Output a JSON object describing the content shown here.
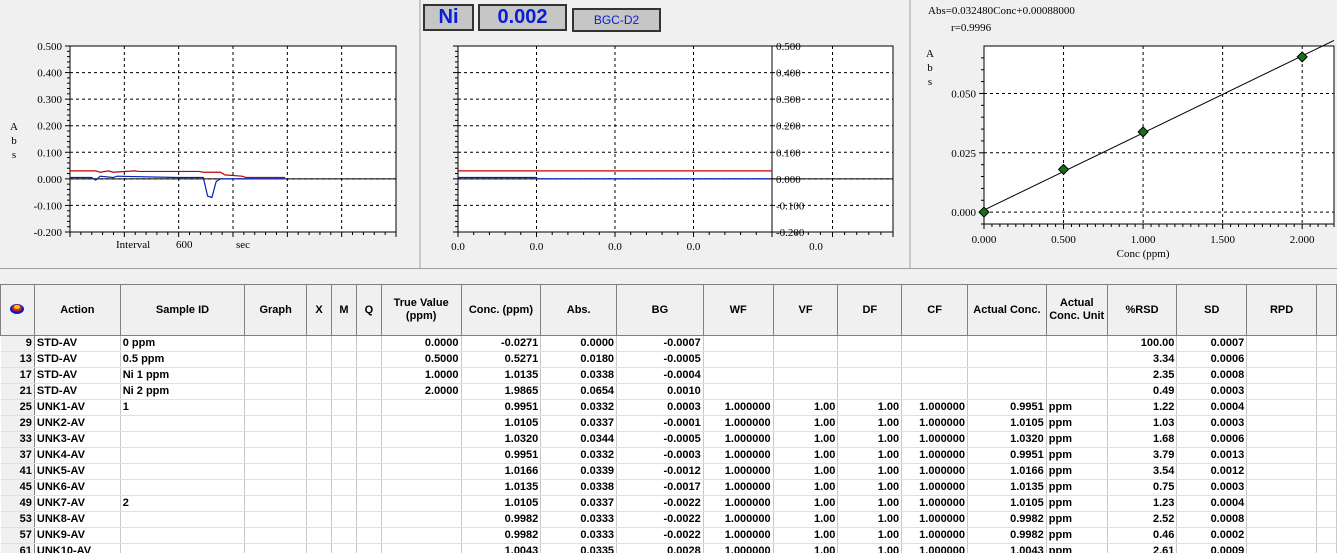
{
  "colors": {
    "signal_red": "#c00000",
    "signal_blue": "#0020c0",
    "accent_blue": "#0a1cd6",
    "marker_green": "#1a6e1a"
  },
  "element": {
    "symbol": "Ni",
    "conc": "0.002",
    "sample": "BGC-D2"
  },
  "chart_data": [
    {
      "type": "line",
      "title": "",
      "ylabel": "Abs",
      "xlabel": "sec",
      "interval_label": "Interval",
      "interval_value": "600",
      "ylim": [
        -0.2,
        0.5
      ],
      "yticks": [
        "0.500",
        "0.400",
        "0.300",
        "0.200",
        "0.100",
        "0.000",
        "-0.100",
        "-0.200"
      ],
      "grid": true,
      "series": [
        {
          "name": "",
          "color": "#c00000",
          "x": [
            0,
            0.12,
            0.14,
            0.18,
            0.2,
            0.3,
            0.32,
            0.6,
            0.62,
            0.7,
            0.72,
            0.8,
            0.82,
            0.9,
            1.0
          ],
          "y": [
            0.03,
            0.03,
            0.025,
            0.03,
            0.025,
            0.03,
            0.028,
            0.028,
            0.025,
            0.025,
            0.015,
            0.01,
            0.005,
            0.005,
            0.005
          ]
        },
        {
          "name": "",
          "color": "#0020c0",
          "x": [
            0,
            0.1,
            0.12,
            0.14,
            0.2,
            0.22,
            0.5,
            0.62,
            0.64,
            0.66,
            0.68,
            0.7,
            1.0
          ],
          "y": [
            0.005,
            0.005,
            -0.005,
            0.01,
            0.005,
            0.01,
            0.005,
            0.005,
            -0.065,
            -0.07,
            -0.01,
            0.0,
            0.0
          ]
        }
      ]
    },
    {
      "type": "line",
      "title": "",
      "ylim": [
        -0.2,
        0.5
      ],
      "yticks": [
        "0.500",
        "0.400",
        "0.300",
        "0.200",
        "0.100",
        "0.000",
        "-0.100",
        "-0.200"
      ],
      "xticks": [
        "0.0",
        "0.0",
        "0.0",
        "0.0",
        "0.0"
      ],
      "grid": true,
      "series": [
        {
          "name": "",
          "color": "#c00000",
          "x": [
            0,
            1
          ],
          "y": [
            0.03,
            0.03
          ]
        },
        {
          "name": "",
          "color": "#0020c0",
          "x": [
            0,
            0.25,
            0.25,
            1
          ],
          "y": [
            0.005,
            0.005,
            0.0,
            0.0
          ]
        }
      ]
    },
    {
      "type": "scatter",
      "title": "Abs=0.032480Conc+0.00088000",
      "subtitle": "r=0.9996",
      "ylabel": "Abs",
      "xlabel": "Conc (ppm)",
      "xlim": [
        0,
        2.2
      ],
      "ylim": [
        -0.005,
        0.07
      ],
      "xticks": [
        "0.000",
        "0.500",
        "1.000",
        "1.500",
        "2.000"
      ],
      "yticks": [
        "0.050",
        "0.025",
        "0.000"
      ],
      "grid": true,
      "points": {
        "x": [
          0.0,
          0.5,
          1.0,
          2.0
        ],
        "y": [
          0.0,
          0.018,
          0.0338,
          0.0654
        ]
      },
      "fit": {
        "slope": 0.03248,
        "intercept": 0.00088
      }
    }
  ],
  "table": {
    "columns": [
      "Action",
      "Sample ID",
      "Graph",
      "X",
      "M",
      "Q",
      "True Value (ppm)",
      "Conc. (ppm)",
      "Abs.",
      "BG",
      "WF",
      "VF",
      "DF",
      "CF",
      "Actual Conc.",
      "Actual Conc. Unit",
      "%RSD",
      "SD",
      "RPD"
    ],
    "rows": [
      {
        "n": "9",
        "action": "STD-AV",
        "sid": "0 ppm",
        "tv": "0.0000",
        "conc": "-0.0271",
        "abs": "0.0000",
        "bg": "-0.0007",
        "wf": "",
        "vf": "",
        "df": "",
        "cf": "",
        "ac": "",
        "unit": "",
        "rsd": "100.00",
        "sd": "0.0007"
      },
      {
        "n": "13",
        "action": "STD-AV",
        "sid": "0.5 ppm",
        "tv": "0.5000",
        "conc": "0.5271",
        "abs": "0.0180",
        "bg": "-0.0005",
        "wf": "",
        "vf": "",
        "df": "",
        "cf": "",
        "ac": "",
        "unit": "",
        "rsd": "3.34",
        "sd": "0.0006"
      },
      {
        "n": "17",
        "action": "STD-AV",
        "sid": "Ni 1 ppm",
        "tv": "1.0000",
        "conc": "1.0135",
        "abs": "0.0338",
        "bg": "-0.0004",
        "wf": "",
        "vf": "",
        "df": "",
        "cf": "",
        "ac": "",
        "unit": "",
        "rsd": "2.35",
        "sd": "0.0008"
      },
      {
        "n": "21",
        "action": "STD-AV",
        "sid": "Ni 2 ppm",
        "tv": "2.0000",
        "conc": "1.9865",
        "abs": "0.0654",
        "bg": "0.0010",
        "wf": "",
        "vf": "",
        "df": "",
        "cf": "",
        "ac": "",
        "unit": "",
        "rsd": "0.49",
        "sd": "0.0003"
      },
      {
        "n": "25",
        "action": "UNK1-AV",
        "sid": "1",
        "tv": "",
        "conc": "0.9951",
        "abs": "0.0332",
        "bg": "0.0003",
        "wf": "1.000000",
        "vf": "1.00",
        "df": "1.00",
        "cf": "1.000000",
        "ac": "0.9951",
        "unit": "ppm",
        "rsd": "1.22",
        "sd": "0.0004"
      },
      {
        "n": "29",
        "action": "UNK2-AV",
        "sid": "",
        "tv": "",
        "conc": "1.0105",
        "abs": "0.0337",
        "bg": "-0.0001",
        "wf": "1.000000",
        "vf": "1.00",
        "df": "1.00",
        "cf": "1.000000",
        "ac": "1.0105",
        "unit": "ppm",
        "rsd": "1.03",
        "sd": "0.0003"
      },
      {
        "n": "33",
        "action": "UNK3-AV",
        "sid": "",
        "tv": "",
        "conc": "1.0320",
        "abs": "0.0344",
        "bg": "-0.0005",
        "wf": "1.000000",
        "vf": "1.00",
        "df": "1.00",
        "cf": "1.000000",
        "ac": "1.0320",
        "unit": "ppm",
        "rsd": "1.68",
        "sd": "0.0006"
      },
      {
        "n": "37",
        "action": "UNK4-AV",
        "sid": "",
        "tv": "",
        "conc": "0.9951",
        "abs": "0.0332",
        "bg": "-0.0003",
        "wf": "1.000000",
        "vf": "1.00",
        "df": "1.00",
        "cf": "1.000000",
        "ac": "0.9951",
        "unit": "ppm",
        "rsd": "3.79",
        "sd": "0.0013"
      },
      {
        "n": "41",
        "action": "UNK5-AV",
        "sid": "",
        "tv": "",
        "conc": "1.0166",
        "abs": "0.0339",
        "bg": "-0.0012",
        "wf": "1.000000",
        "vf": "1.00",
        "df": "1.00",
        "cf": "1.000000",
        "ac": "1.0166",
        "unit": "ppm",
        "rsd": "3.54",
        "sd": "0.0012"
      },
      {
        "n": "45",
        "action": "UNK6-AV",
        "sid": "",
        "tv": "",
        "conc": "1.0135",
        "abs": "0.0338",
        "bg": "-0.0017",
        "wf": "1.000000",
        "vf": "1.00",
        "df": "1.00",
        "cf": "1.000000",
        "ac": "1.0135",
        "unit": "ppm",
        "rsd": "0.75",
        "sd": "0.0003"
      },
      {
        "n": "49",
        "action": "UNK7-AV",
        "sid": "2",
        "tv": "",
        "conc": "1.0105",
        "abs": "0.0337",
        "bg": "-0.0022",
        "wf": "1.000000",
        "vf": "1.00",
        "df": "1.00",
        "cf": "1.000000",
        "ac": "1.0105",
        "unit": "ppm",
        "rsd": "1.23",
        "sd": "0.0004"
      },
      {
        "n": "53",
        "action": "UNK8-AV",
        "sid": "",
        "tv": "",
        "conc": "0.9982",
        "abs": "0.0333",
        "bg": "-0.0022",
        "wf": "1.000000",
        "vf": "1.00",
        "df": "1.00",
        "cf": "1.000000",
        "ac": "0.9982",
        "unit": "ppm",
        "rsd": "2.52",
        "sd": "0.0008"
      },
      {
        "n": "57",
        "action": "UNK9-AV",
        "sid": "",
        "tv": "",
        "conc": "0.9982",
        "abs": "0.0333",
        "bg": "-0.0022",
        "wf": "1.000000",
        "vf": "1.00",
        "df": "1.00",
        "cf": "1.000000",
        "ac": "0.9982",
        "unit": "ppm",
        "rsd": "0.46",
        "sd": "0.0002"
      },
      {
        "n": "61",
        "action": "UNK10-AV",
        "sid": "",
        "tv": "",
        "conc": "1.0043",
        "abs": "0.0335",
        "bg": "0.0028",
        "wf": "1.000000",
        "vf": "1.00",
        "df": "1.00",
        "cf": "1.000000",
        "ac": "1.0043",
        "unit": "ppm",
        "rsd": "2.61",
        "sd": "0.0009"
      }
    ]
  }
}
